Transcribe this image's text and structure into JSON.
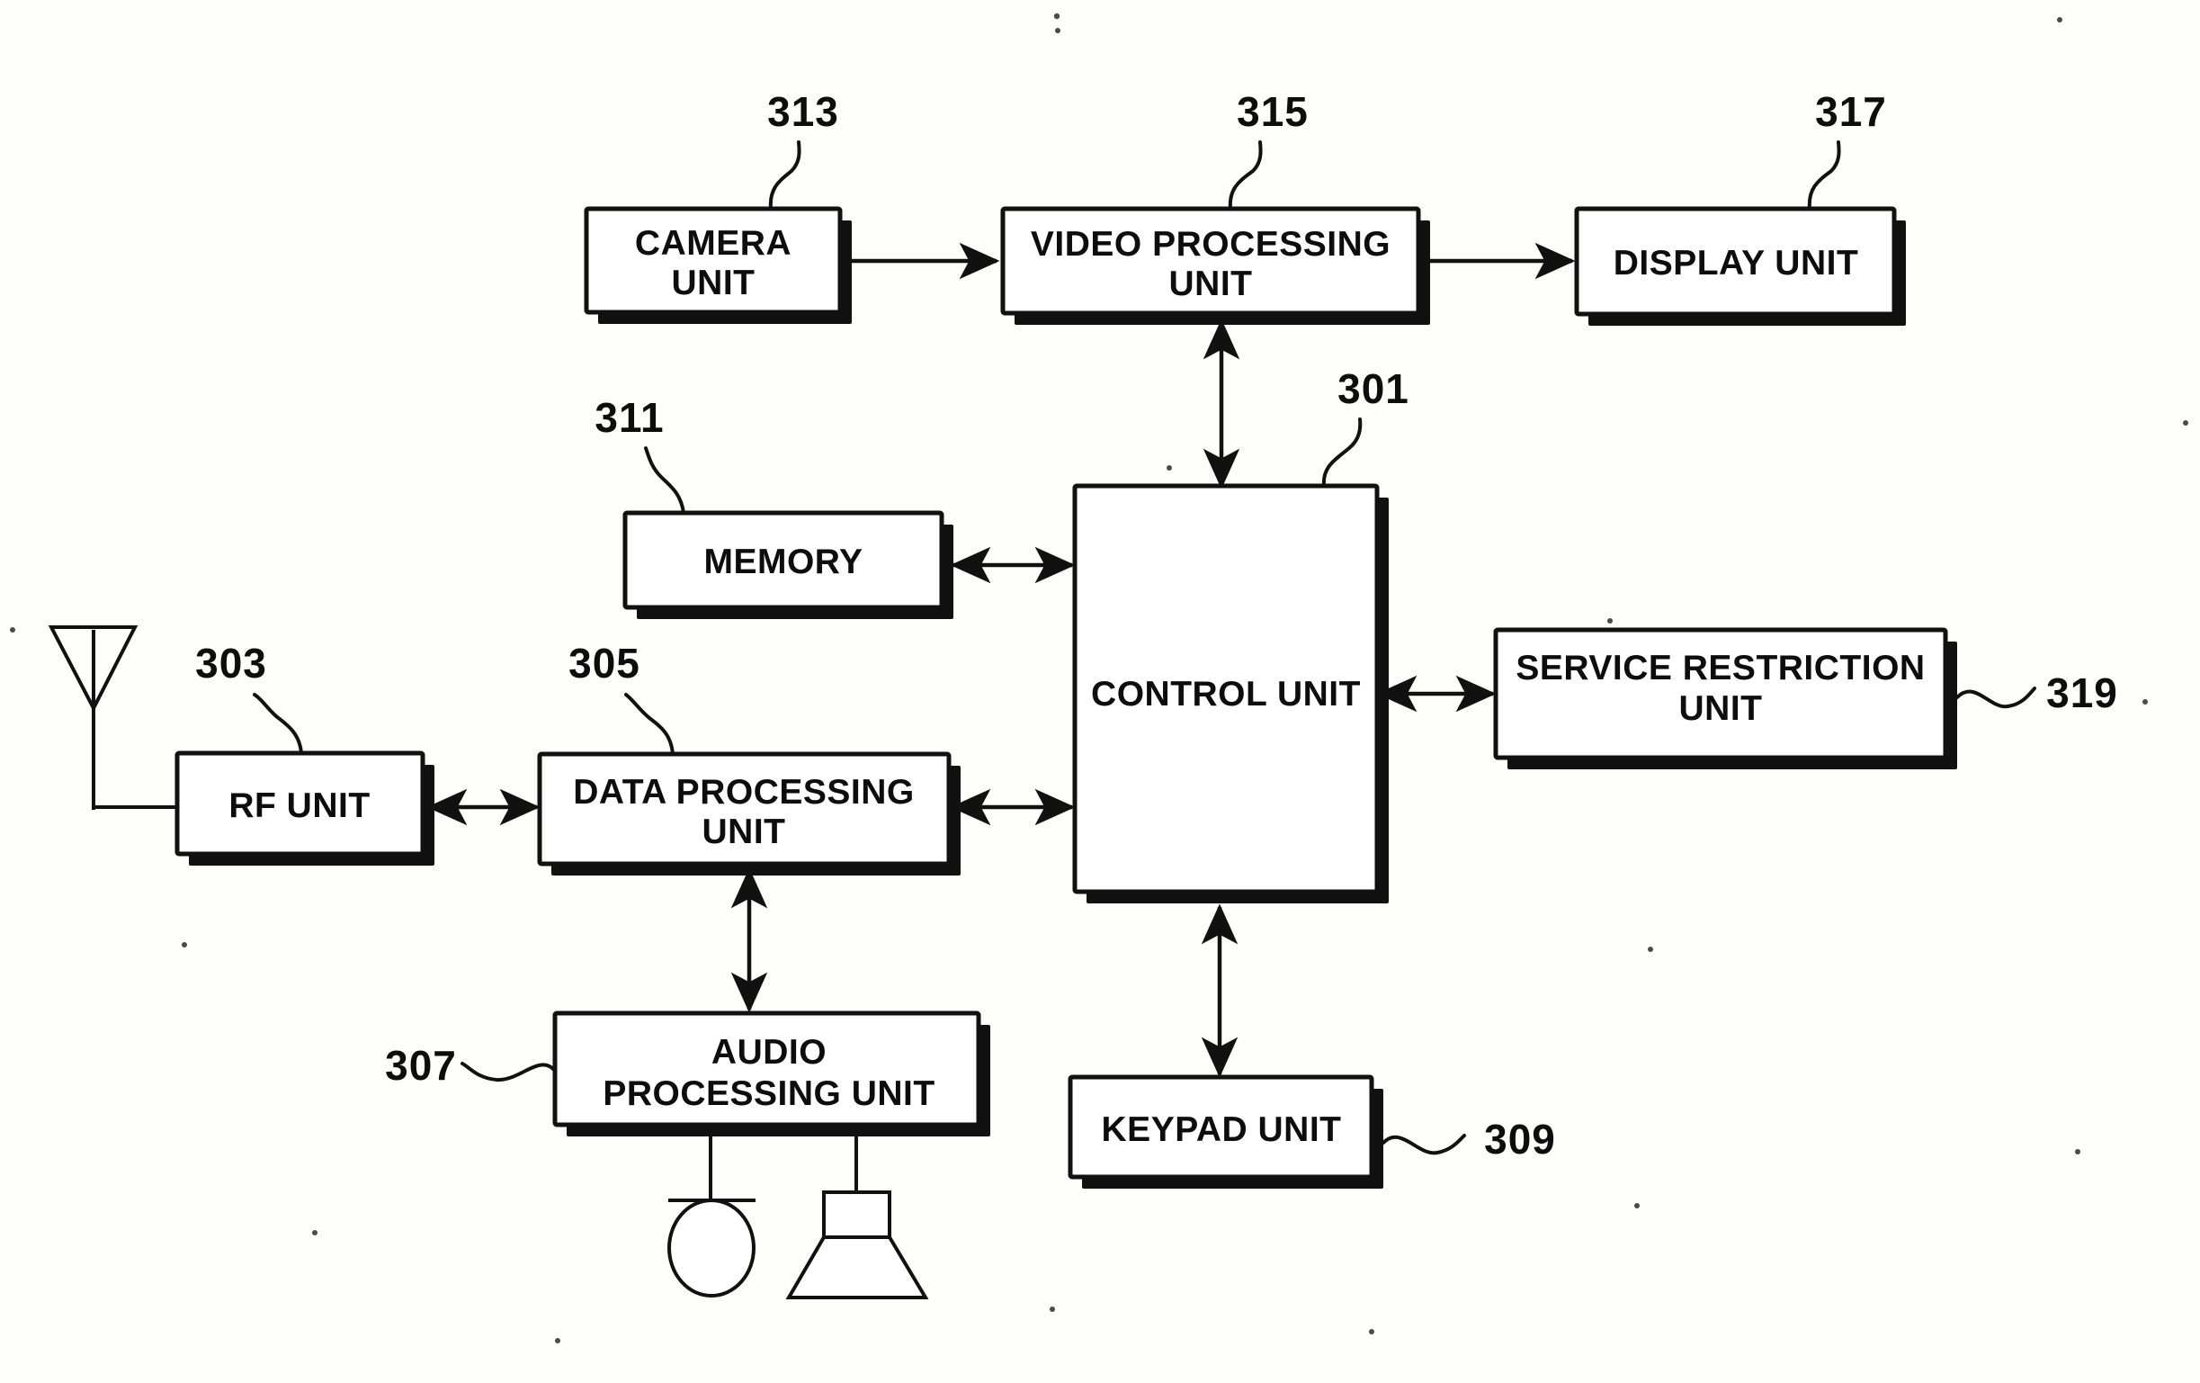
{
  "figure": {
    "title": "Mobile terminal block diagram",
    "ink_color": "#111111",
    "background_color": "#fdfdfc"
  },
  "blocks": [
    {
      "id": "camera",
      "ref": "313",
      "lines": [
        "CAMERA",
        "UNIT"
      ]
    },
    {
      "id": "video",
      "ref": "315",
      "lines": [
        "VIDEO PROCESSING",
        "UNIT"
      ]
    },
    {
      "id": "display",
      "ref": "317",
      "lines": [
        "DISPLAY UNIT"
      ]
    },
    {
      "id": "memory",
      "ref": "311",
      "lines": [
        "MEMORY"
      ]
    },
    {
      "id": "control",
      "ref": "301",
      "lines": [
        "CONTROL UNIT"
      ]
    },
    {
      "id": "service",
      "ref": "319",
      "lines": [
        "SERVICE RESTRICTION",
        "UNIT"
      ]
    },
    {
      "id": "rf",
      "ref": "303",
      "lines": [
        "RF UNIT"
      ]
    },
    {
      "id": "data",
      "ref": "305",
      "lines": [
        "DATA PROCESSING",
        "UNIT"
      ]
    },
    {
      "id": "audio",
      "ref": "307",
      "lines": [
        "AUDIO",
        "PROCESSING UNIT"
      ]
    },
    {
      "id": "keypad",
      "ref": "309",
      "lines": [
        "KEYPAD UNIT"
      ]
    }
  ],
  "labels": {
    "camera_l1": "CAMERA",
    "camera_l2": "UNIT",
    "video_l1": "VIDEO PROCESSING",
    "video_l2": "UNIT",
    "display_l1": "DISPLAY UNIT",
    "memory_l1": "MEMORY",
    "control_l1": "CONTROL UNIT",
    "service_l1": "SERVICE RESTRICTION",
    "service_l2": "UNIT",
    "rf_l1": "RF UNIT",
    "data_l1": "DATA PROCESSING",
    "data_l2": "UNIT",
    "audio_l1": "AUDIO",
    "audio_l2": "PROCESSING UNIT",
    "keypad_l1": "KEYPAD UNIT"
  },
  "refs": {
    "camera": "313",
    "video": "315",
    "display": "317",
    "memory": "311",
    "control": "301",
    "service": "319",
    "rf": "303",
    "data": "305",
    "audio": "307",
    "keypad": "309"
  },
  "connections": [
    {
      "from": "camera",
      "to": "video",
      "type": "single-arrow",
      "direction": "right"
    },
    {
      "from": "video",
      "to": "display",
      "type": "single-arrow",
      "direction": "right"
    },
    {
      "from": "video",
      "to": "control",
      "type": "double-arrow",
      "direction": "vertical"
    },
    {
      "from": "memory",
      "to": "control",
      "type": "double-arrow",
      "direction": "horizontal"
    },
    {
      "from": "control",
      "to": "service",
      "type": "double-arrow",
      "direction": "horizontal"
    },
    {
      "from": "antenna",
      "to": "rf",
      "type": "line",
      "direction": "right"
    },
    {
      "from": "rf",
      "to": "data",
      "type": "double-arrow",
      "direction": "horizontal"
    },
    {
      "from": "data",
      "to": "control",
      "type": "double-arrow",
      "direction": "horizontal"
    },
    {
      "from": "data",
      "to": "audio",
      "type": "double-arrow",
      "direction": "vertical"
    },
    {
      "from": "control",
      "to": "keypad",
      "type": "double-arrow",
      "direction": "vertical"
    },
    {
      "from": "audio",
      "to": "microphone",
      "type": "line",
      "direction": "down"
    },
    {
      "from": "audio",
      "to": "speaker",
      "type": "line",
      "direction": "down"
    }
  ],
  "symbols": [
    {
      "id": "antenna",
      "name": "antenna-symbol"
    },
    {
      "id": "microphone",
      "name": "microphone-symbol"
    },
    {
      "id": "speaker",
      "name": "speaker-symbol"
    }
  ]
}
